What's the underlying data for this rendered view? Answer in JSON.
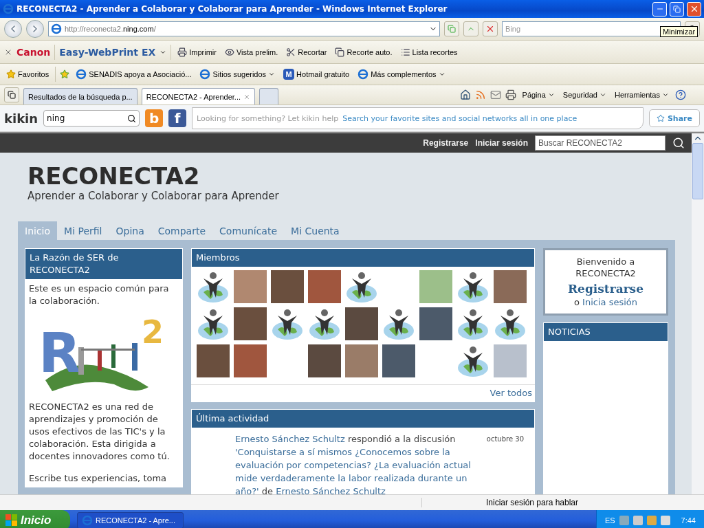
{
  "window": {
    "title": "RECONECTA2 - Aprender a Colaborar y Colaborar para Aprender - Windows Internet Explorer",
    "tooltip": "Minimizar"
  },
  "address_bar": {
    "url": "http://reconecta2.**ning.com**/",
    "search_placeholder": "Bing"
  },
  "canon_toolbar": {
    "brand": "Canon",
    "product": "Easy-WebPrint EX",
    "items": [
      {
        "label": "Imprimir",
        "kind": "print"
      },
      {
        "label": "Vista prelim.",
        "kind": "preview"
      },
      {
        "label": "Recortar",
        "kind": "clip"
      },
      {
        "label": "Recorte auto.",
        "kind": "autoclip"
      },
      {
        "label": "Lista recortes",
        "kind": "list"
      }
    ]
  },
  "favorites_bar": {
    "label": "Favoritos",
    "items": [
      {
        "label": "SENADIS apoya a Asociació...",
        "kind": "page",
        "menu": false
      },
      {
        "label": "Sitios sugeridos",
        "kind": "ie",
        "menu": true
      },
      {
        "label": "Hotmail gratuito",
        "kind": "hotmail",
        "menu": false,
        "glyph": "M"
      },
      {
        "label": "Más complementos",
        "kind": "page",
        "menu": true
      }
    ]
  },
  "tabs": [
    {
      "label": "Resultados de la búsqueda p...",
      "selected": false
    },
    {
      "label": "RECONECTA2 - Aprender...",
      "selected": true
    }
  ],
  "command_bar": [
    "Página",
    "Seguridad",
    "Herramientas"
  ],
  "kikin": {
    "brand": "kikin",
    "search_value": "ning",
    "services": [
      {
        "kind": "blogger",
        "glyph": "b"
      },
      {
        "kind": "facebook",
        "glyph": "f"
      }
    ],
    "prompt": "Looking for something? Let kikin help",
    "link": "Search your favorite sites and social networks all in one place",
    "share": "Share"
  },
  "site": {
    "top_links": [
      "Registrarse",
      "Iniciar sesión"
    ],
    "search_placeholder": "Buscar RECONECTA2",
    "title": "RECONECTA2",
    "tagline": "Aprender a Colaborar y Colaborar para Aprender",
    "nav": [
      {
        "label": "Inicio",
        "selected": true
      },
      {
        "label": "Mi Perfil",
        "selected": false
      },
      {
        "label": "Opina",
        "selected": false
      },
      {
        "label": "Comparte",
        "selected": false
      },
      {
        "label": "Comunícate",
        "selected": false
      },
      {
        "label": "Mi Cuenta",
        "selected": false
      }
    ],
    "reason": {
      "title": "La Razón de SER de RECONECTA2",
      "logo_letter": "R",
      "logo_superscript": "2",
      "intro": "Este es un espacio común para la colaboración.",
      "body": "RECONECTA2 es una red de aprendizajes y promoción de usos efectivos de las TIC's y la colaboración. Esta dirigida a docentes innovadores como tú.",
      "more": "Escribe tus experiencias, toma"
    },
    "members": {
      "title": "Miembros",
      "see_all": "Ver todos",
      "avatars": [
        {
          "kind": "default"
        },
        {
          "kind": "photo"
        },
        {
          "kind": "photo"
        },
        {
          "kind": "photo"
        },
        {
          "kind": "default"
        },
        {
          "kind": "empty"
        },
        {
          "kind": "logo"
        },
        {
          "kind": "default"
        },
        {
          "kind": "photo"
        },
        {
          "kind": "default"
        },
        {
          "kind": "photo"
        },
        {
          "kind": "default"
        },
        {
          "kind": "default"
        },
        {
          "kind": "photo"
        },
        {
          "kind": "default"
        },
        {
          "kind": "photo"
        },
        {
          "kind": "default"
        },
        {
          "kind": "default"
        },
        {
          "kind": "photo"
        },
        {
          "kind": "photo"
        },
        {
          "kind": "empty"
        },
        {
          "kind": "photo"
        },
        {
          "kind": "photo"
        },
        {
          "kind": "photo"
        },
        {
          "kind": "empty"
        },
        {
          "kind": "default"
        },
        {
          "kind": "cartoon"
        }
      ]
    },
    "activity": {
      "title": "Última actividad",
      "entries": [
        {
          "actor": "Ernesto Sánchez Schultz",
          "verb": "respondió a la discusión",
          "topic": "'Conquistarse a sí mismos ¿Conocemos sobre la evaluación por competencias? ¿La evaluación actual mide verdaderamente la labor realizada durante un año?'",
          "by": "de",
          "author": "Ernesto Sánchez Schultz",
          "date": "octubre 30"
        }
      ]
    },
    "welcome": {
      "greeting": "Bienvenido a RECONECTA2",
      "register": "Registrarse",
      "or_text": "o",
      "login": "Inicia sesión"
    },
    "news": {
      "title": "NOTICIAS"
    }
  },
  "chat_bar": {
    "label": "Iniciar sesión para hablar"
  },
  "taskbar": {
    "start": "Inicio",
    "window": "RECONECTA2 - Apre...",
    "language": "ES",
    "time": "7:44"
  }
}
